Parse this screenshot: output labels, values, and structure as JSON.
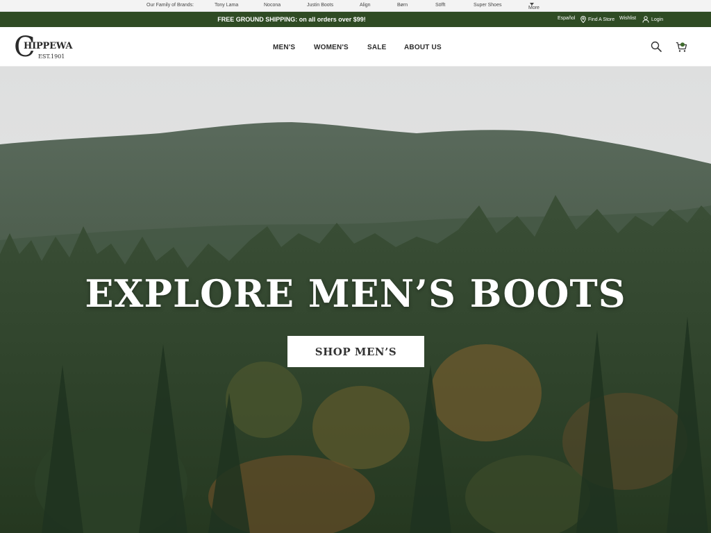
{
  "brands_bar": {
    "label": "Our Family of Brands:",
    "brands": [
      "Tony Lama",
      "Nocona",
      "Justin Boots",
      "Align",
      "Børn",
      "Söfft",
      "Super Shoes"
    ],
    "more": "More"
  },
  "promo_bar": {
    "message": "FREE GROUND SHIPPING: on all orders over $99!",
    "language": "Español",
    "find_store": "Find A Store",
    "wishlist": "Wishlist",
    "login": "Login"
  },
  "header": {
    "logo": {
      "letter": "C",
      "name": "HIPPEWA",
      "est": "EST.1901"
    },
    "nav": [
      "MEN'S",
      "WOMEN'S",
      "SALE",
      "ABOUT US"
    ],
    "icons": {
      "search": "search-icon",
      "cart": "cart-icon"
    }
  },
  "hero": {
    "title": "EXPLORE MEN’S BOOTS",
    "button": "SHOP MEN’S"
  },
  "colors": {
    "promo_bg": "#2f4b24",
    "brand_bar_bg": "#f3f3f3",
    "text_dark": "#2a2a2a"
  }
}
